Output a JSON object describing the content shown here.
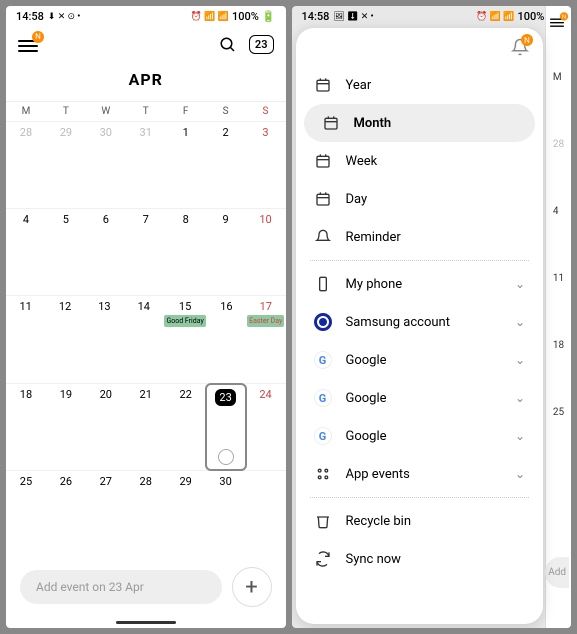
{
  "status": {
    "time": "14:58",
    "battery": "100%",
    "left_icons": "⬇ ✕ ☺",
    "right_icons": "⏰ 📶 📶 100%🔋"
  },
  "header": {
    "today_number": "23",
    "menu_badge": "N"
  },
  "calendar": {
    "month_label": "APR",
    "weekdays": [
      "M",
      "T",
      "W",
      "T",
      "F",
      "S",
      "S"
    ],
    "weeks": [
      [
        {
          "n": "28",
          "dim": true
        },
        {
          "n": "29",
          "dim": true
        },
        {
          "n": "30",
          "dim": true
        },
        {
          "n": "31",
          "dim": true
        },
        {
          "n": "1"
        },
        {
          "n": "2"
        },
        {
          "n": "3",
          "sun": true
        }
      ],
      [
        {
          "n": "4"
        },
        {
          "n": "5"
        },
        {
          "n": "6"
        },
        {
          "n": "7"
        },
        {
          "n": "8"
        },
        {
          "n": "9"
        },
        {
          "n": "10",
          "sun": true
        }
      ],
      [
        {
          "n": "11"
        },
        {
          "n": "12"
        },
        {
          "n": "13"
        },
        {
          "n": "14"
        },
        {
          "n": "15",
          "event": "Good Friday"
        },
        {
          "n": "16"
        },
        {
          "n": "17",
          "sun": true,
          "event": "Easter Day"
        }
      ],
      [
        {
          "n": "18"
        },
        {
          "n": "19"
        },
        {
          "n": "20"
        },
        {
          "n": "21"
        },
        {
          "n": "22"
        },
        {
          "n": "23",
          "today": true,
          "selected": true,
          "smiley": true
        },
        {
          "n": "24",
          "sun": true
        }
      ],
      [
        {
          "n": "25"
        },
        {
          "n": "26"
        },
        {
          "n": "27"
        },
        {
          "n": "28"
        },
        {
          "n": "29"
        },
        {
          "n": "30"
        },
        {
          "n": ""
        }
      ]
    ]
  },
  "add_placeholder": "Add event on 23 Apr",
  "drawer": {
    "views": [
      {
        "icon": "year",
        "label": "Year"
      },
      {
        "icon": "month",
        "label": "Month",
        "selected": true
      },
      {
        "icon": "week",
        "label": "Week"
      },
      {
        "icon": "day",
        "label": "Day"
      },
      {
        "icon": "reminder",
        "label": "Reminder"
      }
    ],
    "accounts": [
      {
        "icon": "phone",
        "label": "My phone"
      },
      {
        "icon": "samsung",
        "label": "Samsung account"
      },
      {
        "icon": "google",
        "label": "Google"
      },
      {
        "icon": "google",
        "label": "Google"
      },
      {
        "icon": "google",
        "label": "Google"
      },
      {
        "icon": "apps",
        "label": "App events"
      }
    ],
    "footer": [
      {
        "icon": "trash",
        "label": "Recycle bin"
      },
      {
        "icon": "sync",
        "label": "Sync now"
      }
    ]
  },
  "strip_days": [
    "M",
    "28",
    "4",
    "11",
    "18",
    "25"
  ],
  "add_stub": "Add"
}
